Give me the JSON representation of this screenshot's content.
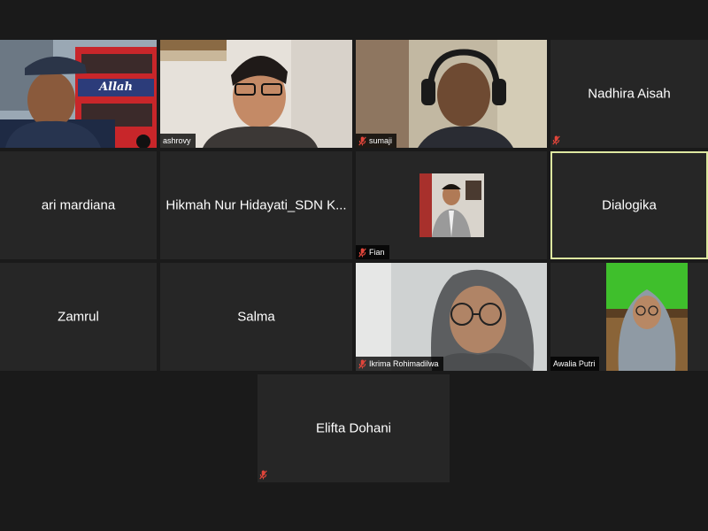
{
  "meeting": {
    "participants": [
      {
        "name": "",
        "video": true,
        "muted": false
      },
      {
        "name": "ashrovy",
        "video": true,
        "muted": false
      },
      {
        "name": "sumaji",
        "video": true,
        "muted": true
      },
      {
        "name": "Nadhira Aisah",
        "video": false,
        "muted": true
      },
      {
        "name": "ari mardiana",
        "video": false,
        "muted": false
      },
      {
        "name": "Hikmah Nur Hidayati_SDN K...",
        "video": false,
        "muted": false
      },
      {
        "name": "Fian",
        "video": true,
        "muted": true
      },
      {
        "name": "Dialogika",
        "video": false,
        "muted": false,
        "active_speaker": true
      },
      {
        "name": "Zamrul",
        "video": false,
        "muted": false
      },
      {
        "name": "Salma",
        "video": false,
        "muted": false
      },
      {
        "name": "Ikrima Rohimadilwa",
        "video": true,
        "muted": true
      },
      {
        "name": "Awalia Putri",
        "video": true,
        "muted": false
      },
      {
        "name": "Elifta Dohani",
        "video": false,
        "muted": true
      }
    ],
    "bus_sign_text": "Allah",
    "colors": {
      "background": "#1a1a1a",
      "tile": "#262626",
      "active_border": "#dde7a0",
      "muted_icon": "#e0453a",
      "green_screen": "#3fbf2c"
    }
  }
}
